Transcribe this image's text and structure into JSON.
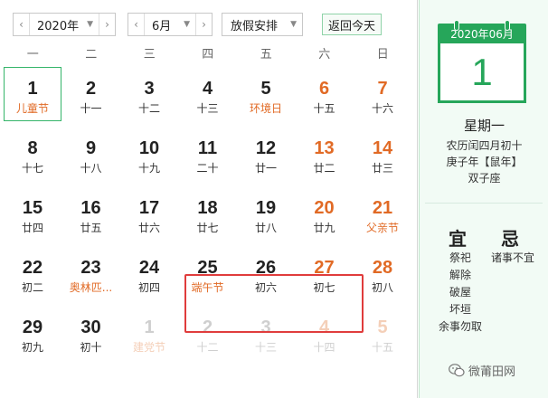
{
  "toolbar": {
    "year": "2020年",
    "month": "6月",
    "holiday_select": "放假安排",
    "today_button": "返回今天"
  },
  "weekdays": [
    "一",
    "二",
    "三",
    "四",
    "五",
    "六",
    "日"
  ],
  "days": [
    {
      "n": "1",
      "s": "儿童节",
      "fest": true,
      "weekend": false,
      "dim": false,
      "today": true
    },
    {
      "n": "2",
      "s": "十一",
      "fest": false,
      "weekend": false,
      "dim": false
    },
    {
      "n": "3",
      "s": "十二",
      "fest": false,
      "weekend": false,
      "dim": false
    },
    {
      "n": "4",
      "s": "十三",
      "fest": false,
      "weekend": false,
      "dim": false
    },
    {
      "n": "5",
      "s": "环境日",
      "fest": true,
      "weekend": false,
      "dim": false
    },
    {
      "n": "6",
      "s": "十五",
      "fest": false,
      "weekend": true,
      "dim": false
    },
    {
      "n": "7",
      "s": "十六",
      "fest": false,
      "weekend": true,
      "dim": false
    },
    {
      "n": "8",
      "s": "十七",
      "fest": false,
      "weekend": false,
      "dim": false
    },
    {
      "n": "9",
      "s": "十八",
      "fest": false,
      "weekend": false,
      "dim": false
    },
    {
      "n": "10",
      "s": "十九",
      "fest": false,
      "weekend": false,
      "dim": false
    },
    {
      "n": "11",
      "s": "二十",
      "fest": false,
      "weekend": false,
      "dim": false
    },
    {
      "n": "12",
      "s": "廿一",
      "fest": false,
      "weekend": false,
      "dim": false
    },
    {
      "n": "13",
      "s": "廿二",
      "fest": false,
      "weekend": true,
      "dim": false
    },
    {
      "n": "14",
      "s": "廿三",
      "fest": false,
      "weekend": true,
      "dim": false
    },
    {
      "n": "15",
      "s": "廿四",
      "fest": false,
      "weekend": false,
      "dim": false
    },
    {
      "n": "16",
      "s": "廿五",
      "fest": false,
      "weekend": false,
      "dim": false
    },
    {
      "n": "17",
      "s": "廿六",
      "fest": false,
      "weekend": false,
      "dim": false
    },
    {
      "n": "18",
      "s": "廿七",
      "fest": false,
      "weekend": false,
      "dim": false
    },
    {
      "n": "19",
      "s": "廿八",
      "fest": false,
      "weekend": false,
      "dim": false
    },
    {
      "n": "20",
      "s": "廿九",
      "fest": false,
      "weekend": true,
      "dim": false
    },
    {
      "n": "21",
      "s": "父亲节",
      "fest": true,
      "weekend": true,
      "dim": false
    },
    {
      "n": "22",
      "s": "初二",
      "fest": false,
      "weekend": false,
      "dim": false
    },
    {
      "n": "23",
      "s": "奥林匹...",
      "fest": true,
      "weekend": false,
      "dim": false
    },
    {
      "n": "24",
      "s": "初四",
      "fest": false,
      "weekend": false,
      "dim": false
    },
    {
      "n": "25",
      "s": "端午节",
      "fest": true,
      "weekend": false,
      "dim": false
    },
    {
      "n": "26",
      "s": "初六",
      "fest": false,
      "weekend": false,
      "dim": false
    },
    {
      "n": "27",
      "s": "初七",
      "fest": false,
      "weekend": true,
      "dim": false
    },
    {
      "n": "28",
      "s": "初八",
      "fest": false,
      "weekend": true,
      "dim": false
    },
    {
      "n": "29",
      "s": "初九",
      "fest": false,
      "weekend": false,
      "dim": false
    },
    {
      "n": "30",
      "s": "初十",
      "fest": false,
      "weekend": false,
      "dim": false
    },
    {
      "n": "1",
      "s": "建党节",
      "fest": true,
      "weekend": false,
      "dim": true
    },
    {
      "n": "2",
      "s": "十二",
      "fest": false,
      "weekend": false,
      "dim": true
    },
    {
      "n": "3",
      "s": "十三",
      "fest": false,
      "weekend": false,
      "dim": true
    },
    {
      "n": "4",
      "s": "十四",
      "fest": false,
      "weekend": true,
      "dim": true
    },
    {
      "n": "5",
      "s": "十五",
      "fest": false,
      "weekend": true,
      "dim": true
    }
  ],
  "side": {
    "icon_header": "2020年06月",
    "icon_day": "1",
    "weekday": "星期一",
    "lunar_line1": "农历闰四月初十",
    "lunar_line2": "庚子年【鼠年】",
    "lunar_line3": "双子座",
    "yi_title": "宜",
    "ji_title": "忌",
    "yi_items": [
      "祭祀",
      "解除",
      "破屋",
      "坏垣",
      "余事勿取"
    ],
    "ji_items": [
      "诸事不宜"
    ]
  },
  "watermark": "微莆田网",
  "colors": {
    "accent_green": "#26a65a",
    "weekend_orange": "#e16a25",
    "highlight_red": "#e03c3c"
  }
}
